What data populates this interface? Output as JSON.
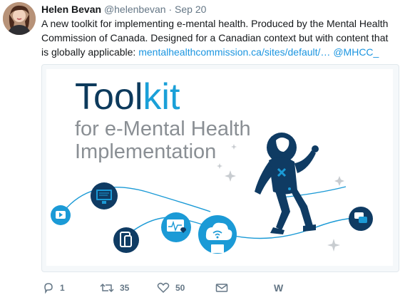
{
  "tweet": {
    "author_name": "Helen Bevan",
    "handle": "@helenbevan",
    "separator": "·",
    "time": "Sep 20",
    "text_main": "A new toolkit for implementing e-mental health. Produced by the Mental Health Commission of Canada. Designed for a Canadian context but with content that is globally applicable:",
    "link_url": "mentalhealthcommission.ca/sites/default/…",
    "mention": "@MHCC_"
  },
  "card_image": {
    "title_line1": "Toolkit",
    "title_line2": "for e-Mental Health",
    "title_line3": "Implementation",
    "colors": {
      "title_dark": "#0d3a5c",
      "title_light": "#1aa0d8",
      "subtitle": "#8a8f94",
      "astronaut": "#0f3b63",
      "icon_blue": "#1b9ad6"
    },
    "icons": [
      "play-icon",
      "desktop-icon",
      "tablet-icon",
      "health-monitor-icon",
      "cloud-wifi-icon",
      "chat-icon",
      "astronaut-icon"
    ]
  },
  "actions": {
    "reply_count": "1",
    "retweet_count": "35",
    "like_count": "50",
    "extra_label": "W"
  },
  "theme": {
    "link_color": "#1b95e0",
    "muted_color": "#657786"
  }
}
